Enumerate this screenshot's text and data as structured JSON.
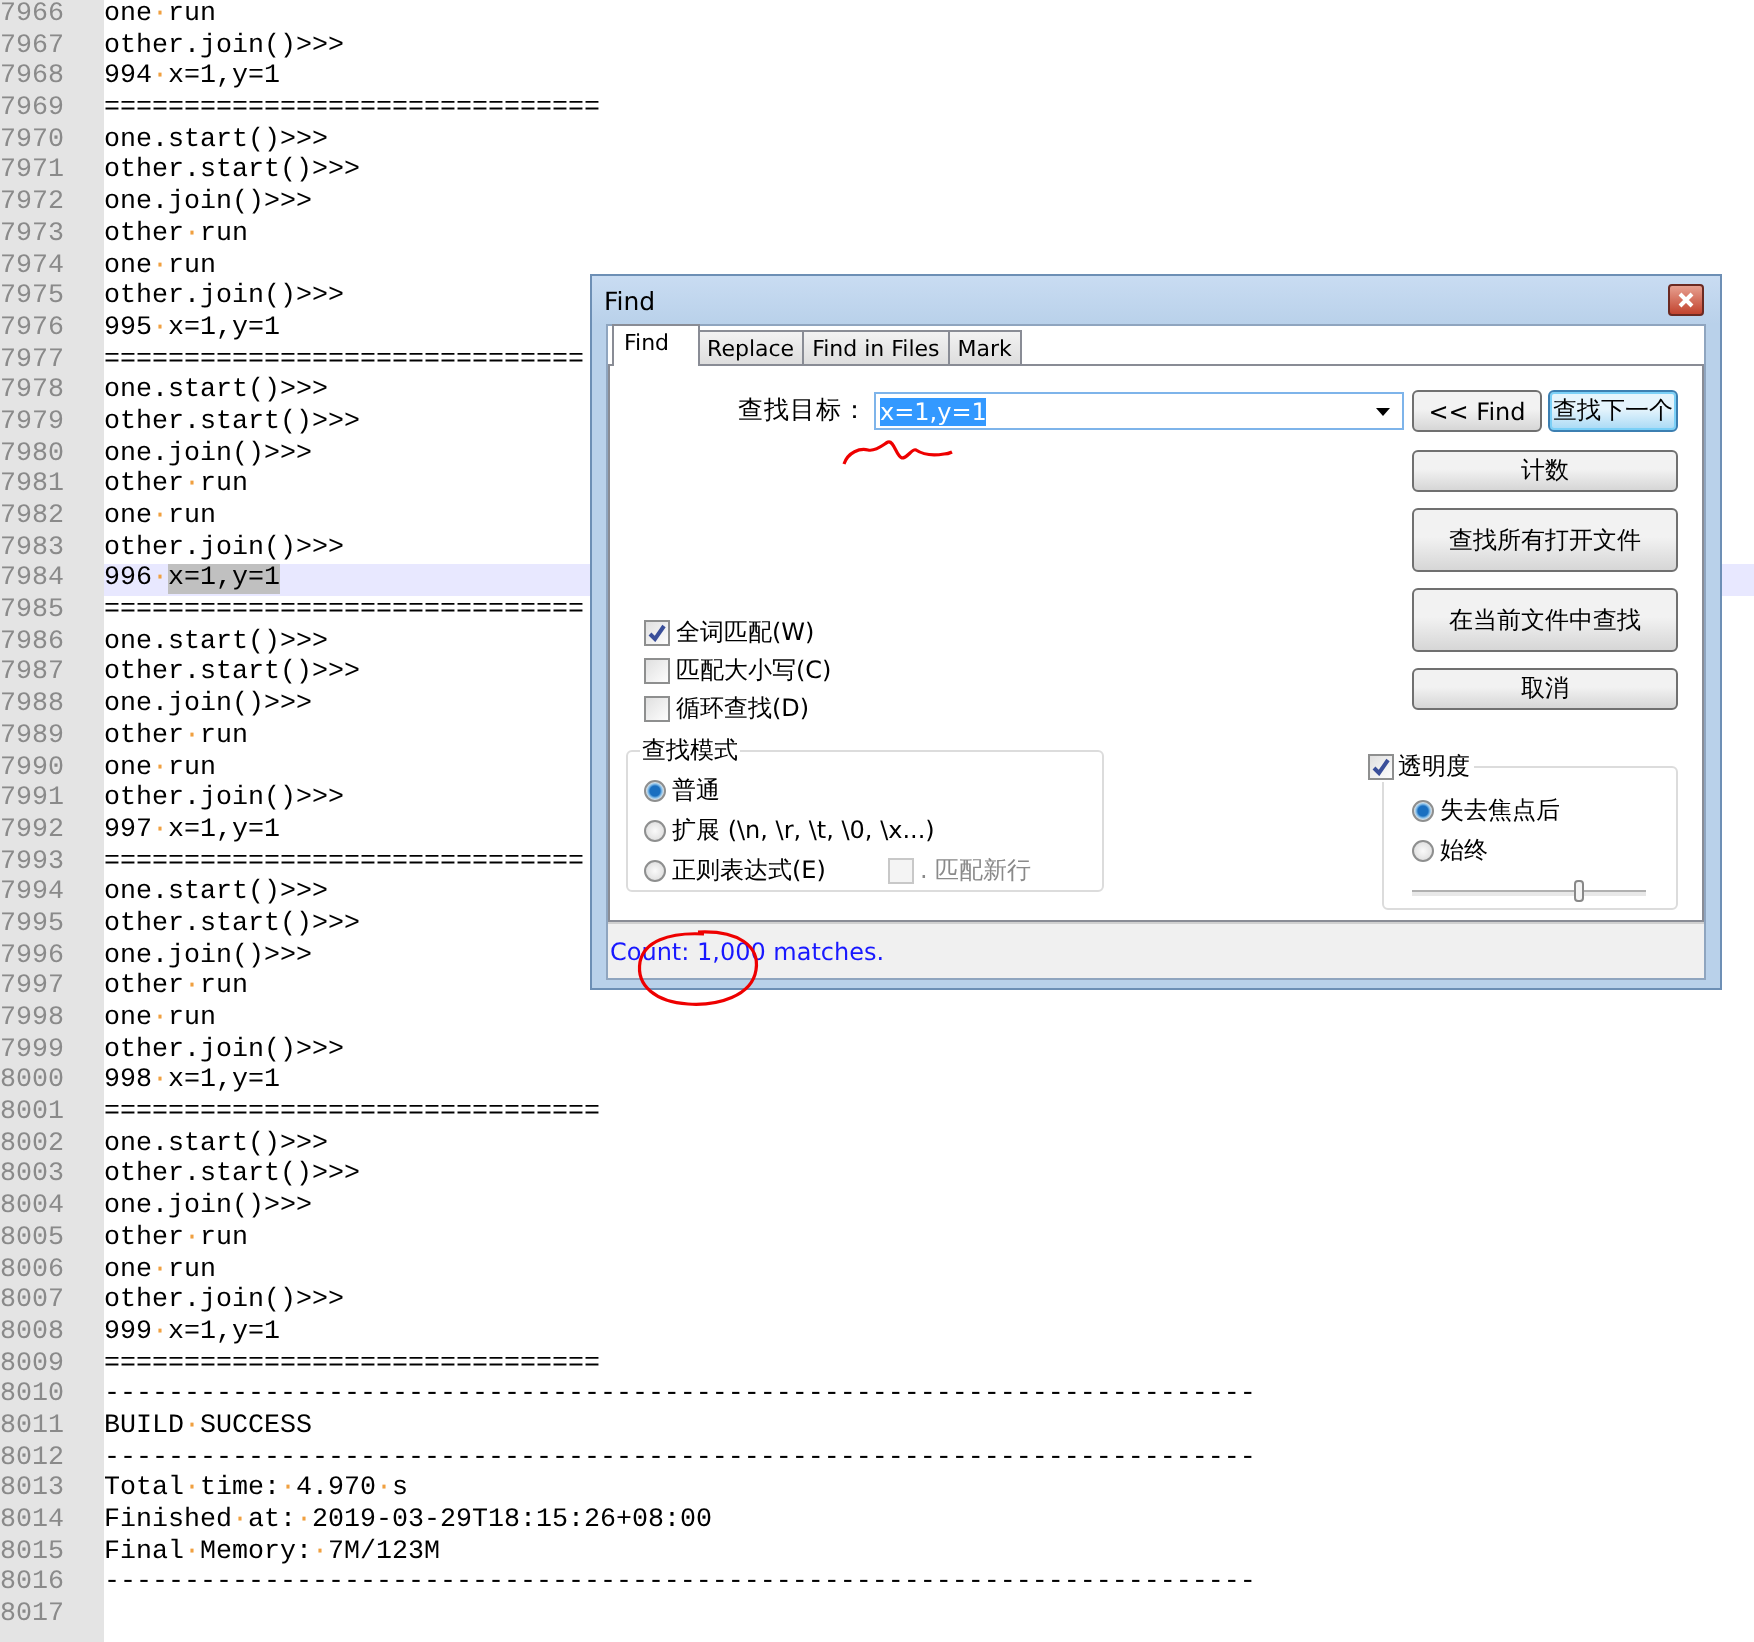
{
  "editor": {
    "lines": [
      {
        "number": "7966",
        "text": "one·run"
      },
      {
        "number": "7967",
        "text": "other.join()>>>"
      },
      {
        "number": "7968",
        "text": "994·x=1,y=1"
      },
      {
        "number": "7969",
        "text": "==============================="
      },
      {
        "number": "7970",
        "text": "one.start()>>>"
      },
      {
        "number": "7971",
        "text": "other.start()>>>"
      },
      {
        "number": "7972",
        "text": "one.join()>>>"
      },
      {
        "number": "7973",
        "text": "other·run"
      },
      {
        "number": "7974",
        "text": "one·run"
      },
      {
        "number": "7975",
        "text": "other.join()>>>"
      },
      {
        "number": "7976",
        "text": "995·x=1,y=1"
      },
      {
        "number": "7977",
        "text": "=============================="
      },
      {
        "number": "7978",
        "text": "one.start()>>>"
      },
      {
        "number": "7979",
        "text": "other.start()>>>"
      },
      {
        "number": "7980",
        "text": "one.join()>>>"
      },
      {
        "number": "7981",
        "text": "other·run"
      },
      {
        "number": "7982",
        "text": "one·run"
      },
      {
        "number": "7983",
        "text": "other.join()>>>"
      },
      {
        "number": "7984",
        "text": "996·",
        "match": "x=1,y=1",
        "current": true
      },
      {
        "number": "7985",
        "text": "=============================="
      },
      {
        "number": "7986",
        "text": "one.start()>>>"
      },
      {
        "number": "7987",
        "text": "other.start()>>>"
      },
      {
        "number": "7988",
        "text": "one.join()>>>"
      },
      {
        "number": "7989",
        "text": "other·run"
      },
      {
        "number": "7990",
        "text": "one·run"
      },
      {
        "number": "7991",
        "text": "other.join()>>>"
      },
      {
        "number": "7992",
        "text": "997·x=1,y=1"
      },
      {
        "number": "7993",
        "text": "=============================="
      },
      {
        "number": "7994",
        "text": "one.start()>>>"
      },
      {
        "number": "7995",
        "text": "other.start()>>>"
      },
      {
        "number": "7996",
        "text": "one.join()>>>"
      },
      {
        "number": "7997",
        "text": "other·run"
      },
      {
        "number": "7998",
        "text": "one·run"
      },
      {
        "number": "7999",
        "text": "other.join()>>>"
      },
      {
        "number": "8000",
        "text": "998·x=1,y=1"
      },
      {
        "number": "8001",
        "text": "==============================="
      },
      {
        "number": "8002",
        "text": "one.start()>>>"
      },
      {
        "number": "8003",
        "text": "other.start()>>>"
      },
      {
        "number": "8004",
        "text": "one.join()>>>"
      },
      {
        "number": "8005",
        "text": "other·run"
      },
      {
        "number": "8006",
        "text": "one·run"
      },
      {
        "number": "8007",
        "text": "other.join()>>>"
      },
      {
        "number": "8008",
        "text": "999·x=1,y=1"
      },
      {
        "number": "8009",
        "text": "==============================="
      },
      {
        "number": "8010",
        "text": "------------------------------------------------------------------------"
      },
      {
        "number": "8011",
        "text": "BUILD·SUCCESS"
      },
      {
        "number": "8012",
        "text": "------------------------------------------------------------------------"
      },
      {
        "number": "8013",
        "text": "Total·time:·4.970·s"
      },
      {
        "number": "8014",
        "text": "Finished·at:·2019-03-29T18:15:26+08:00"
      },
      {
        "number": "8015",
        "text": "Final·Memory:·7M/123M"
      },
      {
        "number": "8016",
        "text": "------------------------------------------------------------------------"
      },
      {
        "number": "8017"
      }
    ]
  },
  "find_dialog": {
    "title": "Find",
    "tabs": [
      {
        "label": "Find",
        "selected": true
      },
      {
        "label": "Replace",
        "selected": false
      },
      {
        "label": "Find in Files",
        "selected": false
      },
      {
        "label": "Mark",
        "selected": false
      }
    ],
    "search_label": "查找目标：",
    "search_value": "x=1,y=1",
    "value_selected": true,
    "button_rows": [
      [
        {
          "label": "<< Find",
          "focused": false
        },
        {
          "label": "查找下一个",
          "focused": true
        }
      ],
      [
        {
          "label": "计数",
          "focused": false
        }
      ],
      [
        {
          "label": "查找所有打开文件",
          "focused": false
        }
      ],
      [
        {
          "label": "在当前文件中查找",
          "focused": false
        }
      ],
      [
        {
          "label": "取消",
          "focused": false
        }
      ]
    ],
    "options": [
      {
        "label": "全词匹配(W)",
        "checked": true
      },
      {
        "label": "匹配大小写(C)",
        "checked": false
      },
      {
        "label": "循环查找(D)",
        "checked": false
      }
    ],
    "search_mode": {
      "title": "查找模式",
      "modes": [
        {
          "label": "普通",
          "selected": true
        },
        {
          "label": "扩展 (\\n, \\r, \\t, \\0, \\x...)",
          "selected": false
        },
        {
          "label": "正则表达式(E)",
          "selected": false
        }
      ],
      "dot_newline": {
        "label": ". 匹配新行",
        "checked": false,
        "disabled": true
      }
    },
    "transparency": {
      "label": "透明度",
      "checked": true,
      "modes": [
        {
          "label": "失去焦点后",
          "selected": true
        },
        {
          "label": "始终",
          "selected": false
        }
      ],
      "level": 0.72
    },
    "status": "Count: 1,000 matches."
  }
}
